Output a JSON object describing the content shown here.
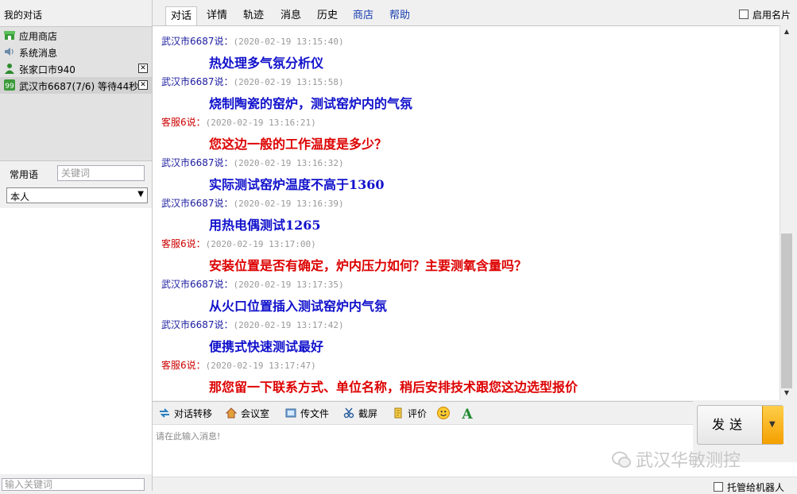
{
  "sidebar": {
    "title": "我的对话",
    "conversations": [
      {
        "label": "应用商店",
        "icon": "store-icon",
        "closable": false
      },
      {
        "label": "系统消息",
        "icon": "speaker-icon",
        "closable": false
      },
      {
        "label": "张家口市940",
        "icon": "user-icon",
        "closable": true
      },
      {
        "label": "武汉市6687(7/6) 等待44秒",
        "icon": "chat-bubble-icon",
        "closable": true
      }
    ],
    "phrases_label": "常用语",
    "phrases_search_placeholder": "关键词",
    "phrases_scope": "本人",
    "bottom_search_placeholder": "输入关键词"
  },
  "tabs": [
    {
      "label": "对话",
      "active": true
    },
    {
      "label": "详情"
    },
    {
      "label": "轨迹"
    },
    {
      "label": "消息"
    },
    {
      "label": "历史"
    },
    {
      "label": "商店",
      "link": true
    },
    {
      "label": "帮助",
      "link": true
    }
  ],
  "header": {
    "card_toggle_label": "启用名片"
  },
  "messages": [
    {
      "role": "customer",
      "sender": "武汉市6687说：",
      "time": "(2020-02-19 13:15:40)",
      "text": "热处理多气氛分析仪"
    },
    {
      "role": "customer",
      "sender": "武汉市6687说：",
      "time": "(2020-02-19 13:15:58)",
      "text": "烧制陶瓷的窑炉，测试窑炉内的气氛"
    },
    {
      "role": "agent",
      "sender": "客服6说：",
      "time": "(2020-02-19 13:16:21)",
      "text": "您这边一般的工作温度是多少？"
    },
    {
      "role": "customer",
      "sender": "武汉市6687说：",
      "time": "(2020-02-19 13:16:32)",
      "text": "实际测试窑炉温度不高于1360"
    },
    {
      "role": "customer",
      "sender": "武汉市6687说：",
      "time": "(2020-02-19 13:16:39)",
      "text": "用热电偶测试1265"
    },
    {
      "role": "agent",
      "sender": "客服6说：",
      "time": "(2020-02-19 13:17:00)",
      "text": "安装位置是否有确定，炉内压力如何？主要测氧含量吗？"
    },
    {
      "role": "customer",
      "sender": "武汉市6687说：",
      "time": "(2020-02-19 13:17:35)",
      "text": "从火口位置插入测试窑炉内气氛"
    },
    {
      "role": "customer",
      "sender": "武汉市6687说：",
      "time": "(2020-02-19 13:17:42)",
      "text": "便携式快速测试最好"
    },
    {
      "role": "agent",
      "sender": "客服6说：",
      "time": "(2020-02-19 13:17:47)",
      "text": "那您留一下联系方式、单位名称，稍后安排技术跟您这边选型报价"
    }
  ],
  "toolbar": {
    "transfer": "对话转移",
    "meeting": "会议室",
    "send_file": "传文件",
    "screenshot": "截屏",
    "rate": "评价"
  },
  "input": {
    "placeholder": "请在此输入消息!"
  },
  "send_button": "发送",
  "watermark": "武汉华敏测控",
  "robot_toggle_label": "托管给机器人",
  "colors": {
    "customer_text": "#1111cc",
    "agent_text": "#dd0000",
    "send_accent": "#f4a000"
  }
}
